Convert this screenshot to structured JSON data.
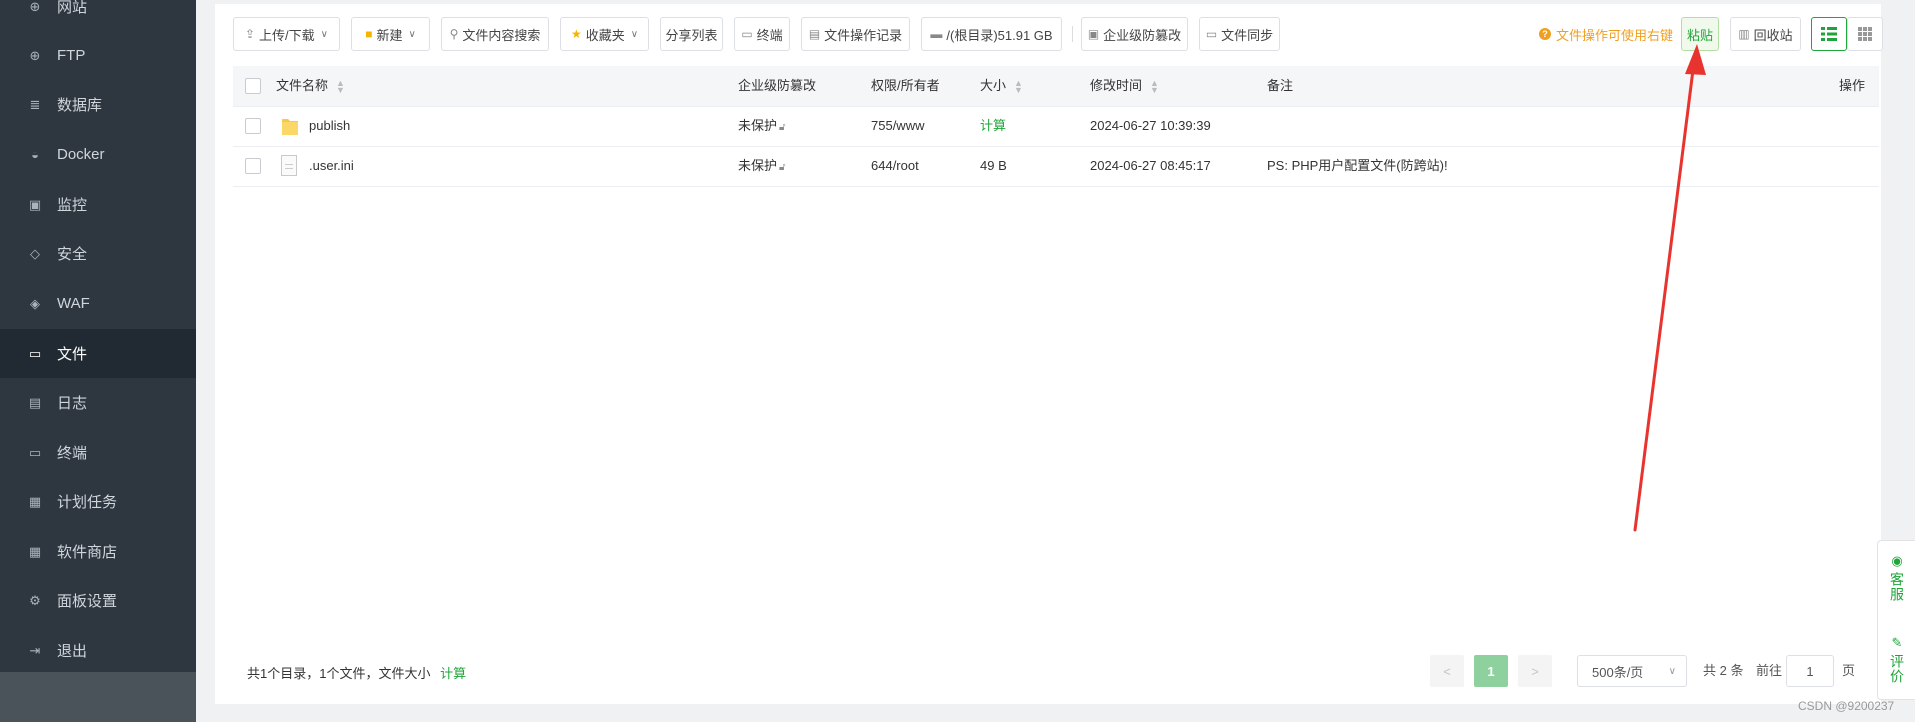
{
  "sidebar": {
    "items": [
      {
        "label": "网站",
        "icon": "globe-icon",
        "glyph": "⊕"
      },
      {
        "label": "FTP",
        "icon": "ftp-icon",
        "glyph": "⊕"
      },
      {
        "label": "数据库",
        "icon": "database-icon",
        "glyph": "≣"
      },
      {
        "label": "Docker",
        "icon": "docker-icon",
        "glyph": "◒"
      },
      {
        "label": "监控",
        "icon": "monitor-icon",
        "glyph": "▣"
      },
      {
        "label": "安全",
        "icon": "shield-icon",
        "glyph": "◇"
      },
      {
        "label": "WAF",
        "icon": "waf-icon",
        "glyph": "◈"
      },
      {
        "label": "文件",
        "icon": "folder-icon",
        "glyph": "▭"
      },
      {
        "label": "日志",
        "icon": "log-icon",
        "glyph": "▤"
      },
      {
        "label": "终端",
        "icon": "terminal-icon",
        "glyph": "▭"
      },
      {
        "label": "计划任务",
        "icon": "calendar-icon",
        "glyph": "▦"
      },
      {
        "label": "软件商店",
        "icon": "apps-icon",
        "glyph": "▦"
      },
      {
        "label": "面板设置",
        "icon": "gear-icon",
        "glyph": "⚙"
      },
      {
        "label": "退出",
        "icon": "logout-icon",
        "glyph": "⇥"
      }
    ],
    "active_index": 7
  },
  "toolbar": {
    "upload_download": "上传/下载",
    "new": "新建",
    "content_search": "文件内容搜索",
    "favorites": "收藏夹",
    "share_list": "分享列表",
    "terminal": "终端",
    "operation_log": "文件操作记录",
    "disk": "/(根目录)51.91 GB",
    "tamper_protect": "企业级防篡改",
    "file_sync": "文件同步",
    "tip": "文件操作可使用右键",
    "tip_icon": "?",
    "paste": "粘贴",
    "recycle_bin": "回收站"
  },
  "table": {
    "headers": {
      "name": "文件名称",
      "tamper": "企业级防篡改",
      "perm": "权限/所有者",
      "size": "大小",
      "mtime": "修改时间",
      "remark": "备注",
      "action": "操作"
    },
    "rows": [
      {
        "name": "publish",
        "type": "folder",
        "tamper": "未保护",
        "perm": "755/www",
        "size": "计算",
        "mtime": "2024-06-27 10:39:39",
        "remark": ""
      },
      {
        "name": ".user.ini",
        "type": "file",
        "tamper": "未保护",
        "perm": "644/root",
        "size": "49 B",
        "mtime": "2024-06-27 08:45:17",
        "remark": "PS: PHP用户配置文件(防跨站)!"
      }
    ]
  },
  "footer": {
    "summary": "共1个目录，1个文件，文件大小",
    "calc": "计算",
    "current_page": "1",
    "page_size": "500条/页",
    "total": "共 2 条",
    "goto_prefix": "前往",
    "goto_value": "1",
    "goto_suffix": "页"
  },
  "float_bar": {
    "service": "客服",
    "review": "评价"
  },
  "watermark": "CSDN @9200237",
  "colors": {
    "accent": "#20a53a",
    "sidebar_bg": "#2e3740",
    "warning": "#f0a020",
    "arrow": "#e8332e"
  }
}
